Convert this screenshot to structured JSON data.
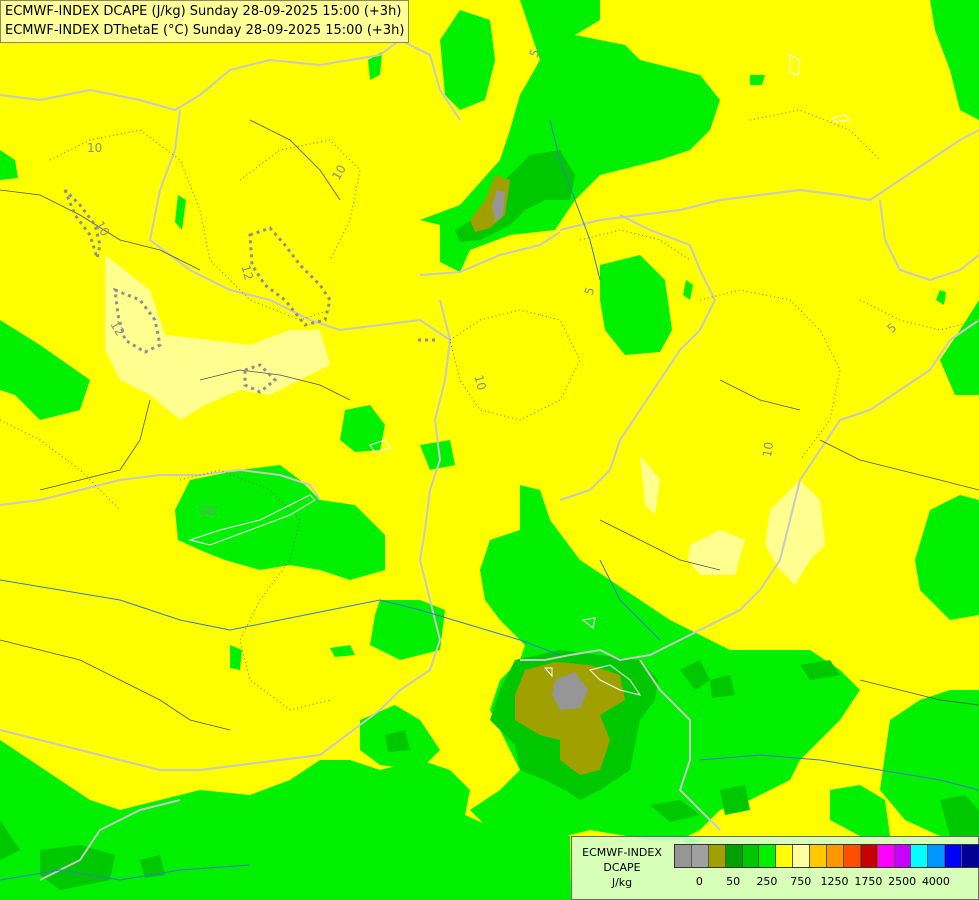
{
  "header": {
    "line1": "ECMWF-INDEX DCAPE (J/kg) Sunday 28-09-2025 15:00 (+3h)",
    "line2": "ECMWF-INDEX DThetaE (°C) Sunday 28-09-2025 15:00 (+3h)"
  },
  "contour_labels": [
    "10",
    "10",
    "10",
    "12",
    "12",
    "10",
    "5",
    "5",
    "10",
    "10",
    "5"
  ],
  "legend": {
    "title_line1": "ECMWF-INDEX",
    "title_line2": "DCAPE",
    "title_line3": "J/kg",
    "colors": [
      "#969696",
      "#a0a0a0",
      "#a0a000",
      "#00a000",
      "#00c800",
      "#00f000",
      "#ffff00",
      "#ffffa0",
      "#ffc800",
      "#ff9600",
      "#ff5000",
      "#c80000",
      "#ff00ff",
      "#c800ff",
      "#00ffff",
      "#0096ff",
      "#0000ff",
      "#000096"
    ],
    "ticks": [
      "0",
      "50",
      "250",
      "750",
      "1250",
      "1750",
      "2500",
      "4000"
    ]
  }
}
